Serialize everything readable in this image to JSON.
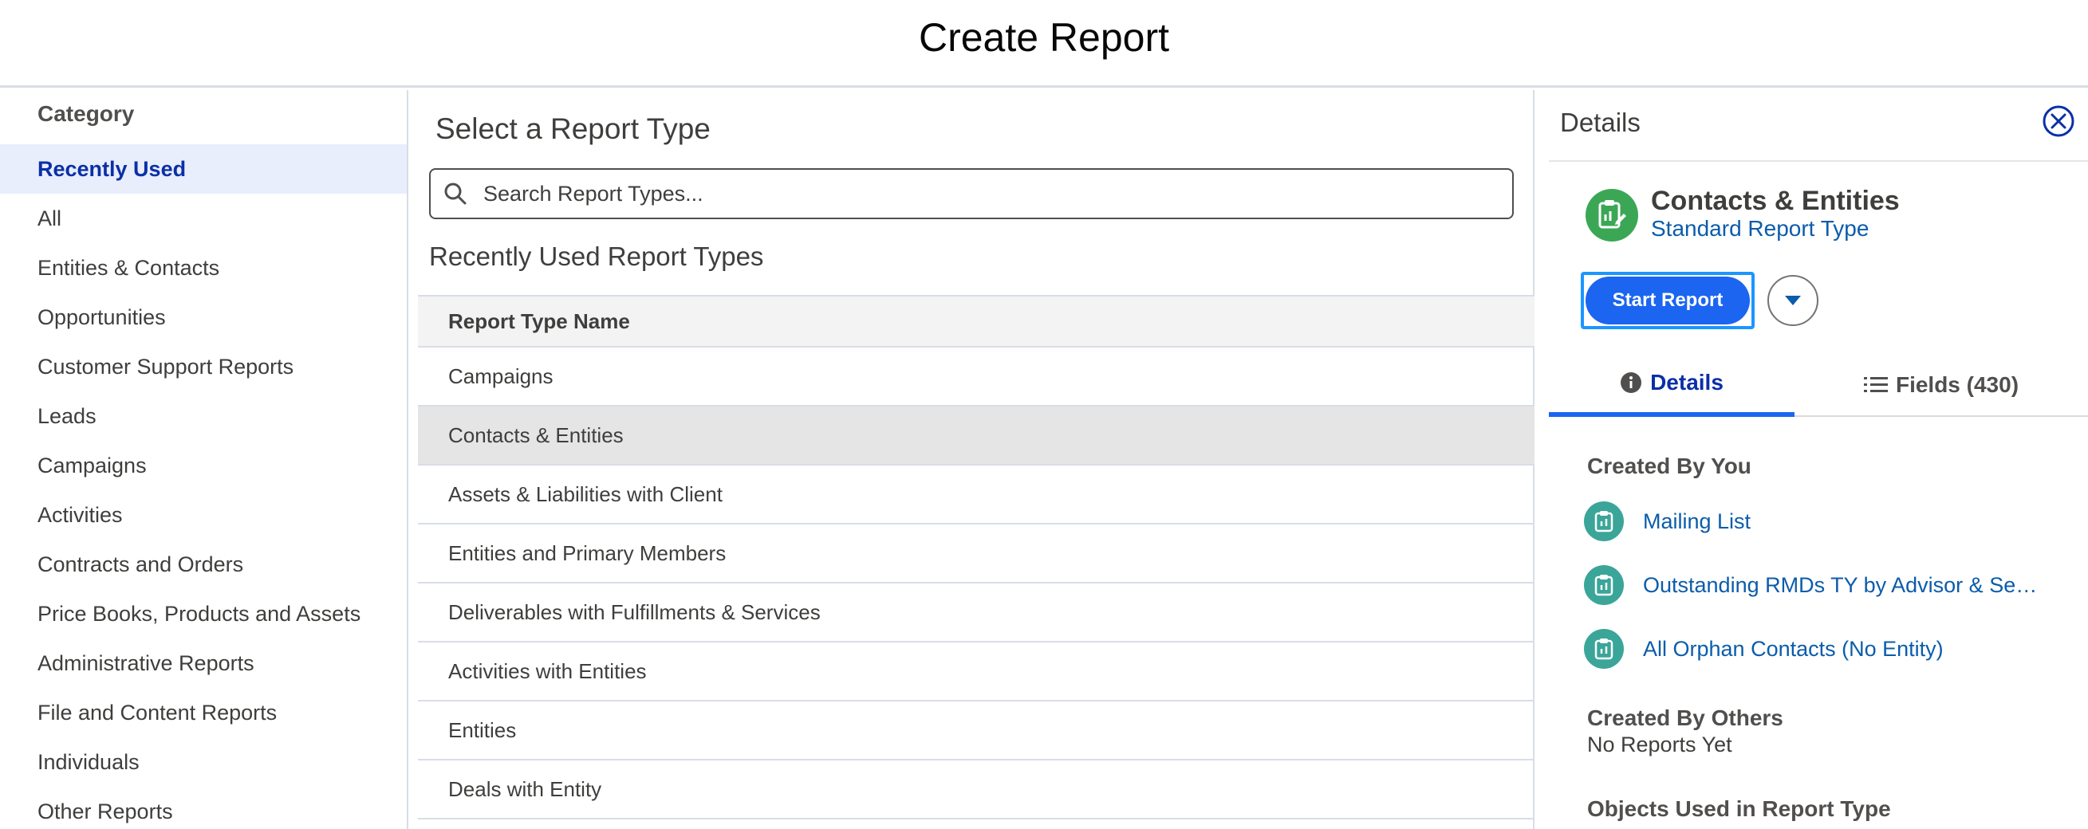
{
  "header": {
    "title": "Create Report"
  },
  "sidebar": {
    "category_title": "Category",
    "items": [
      {
        "label": "Recently Used",
        "active": true
      },
      {
        "label": "All"
      },
      {
        "label": "Entities & Contacts"
      },
      {
        "label": "Opportunities"
      },
      {
        "label": "Customer Support Reports"
      },
      {
        "label": "Leads"
      },
      {
        "label": "Campaigns"
      },
      {
        "label": "Activities"
      },
      {
        "label": "Contracts and Orders"
      },
      {
        "label": "Price Books, Products and Assets"
      },
      {
        "label": "Administrative Reports"
      },
      {
        "label": "File and Content Reports"
      },
      {
        "label": "Individuals"
      },
      {
        "label": "Other Reports"
      }
    ]
  },
  "main": {
    "title": "Select a Report Type",
    "search": {
      "placeholder": "Search Report Types...",
      "value": ""
    },
    "subtitle": "Recently Used Report Types",
    "table": {
      "header": "Report Type Name",
      "rows": [
        "Campaigns",
        "Contacts & Entities",
        "Assets & Liabilities with Client",
        "Entities and Primary Members",
        "Deliverables with Fulfillments & Services",
        "Activities with Entities",
        "Entities",
        "Deals with Entity"
      ],
      "selected_row": "Contacts & Entities"
    }
  },
  "details": {
    "title": "Details",
    "report_type_name": "Contacts & Entities",
    "report_type_kind": "Standard Report Type",
    "start_button": "Start Report",
    "tabs": [
      {
        "label": "Details",
        "icon": "info-icon",
        "active": true
      },
      {
        "label": "Fields (430)",
        "icon": "list-icon"
      }
    ],
    "created_by_you_title": "Created By You",
    "created_by_you": [
      "Mailing List",
      "Outstanding RMDs TY by Advisor & Segment",
      "All Orphan Contacts (No Entity)"
    ],
    "created_by_others_title": "Created By Others",
    "created_by_others_empty": "No Reports Yet",
    "objects_title": "Objects Used in Report Type"
  },
  "colors": {
    "accent": "#1b65f0",
    "active_nav_bg": "#e8eefc",
    "link": "#0b5cab",
    "report_type_icon": "#3ba755",
    "report_icon": "#3ba599"
  }
}
